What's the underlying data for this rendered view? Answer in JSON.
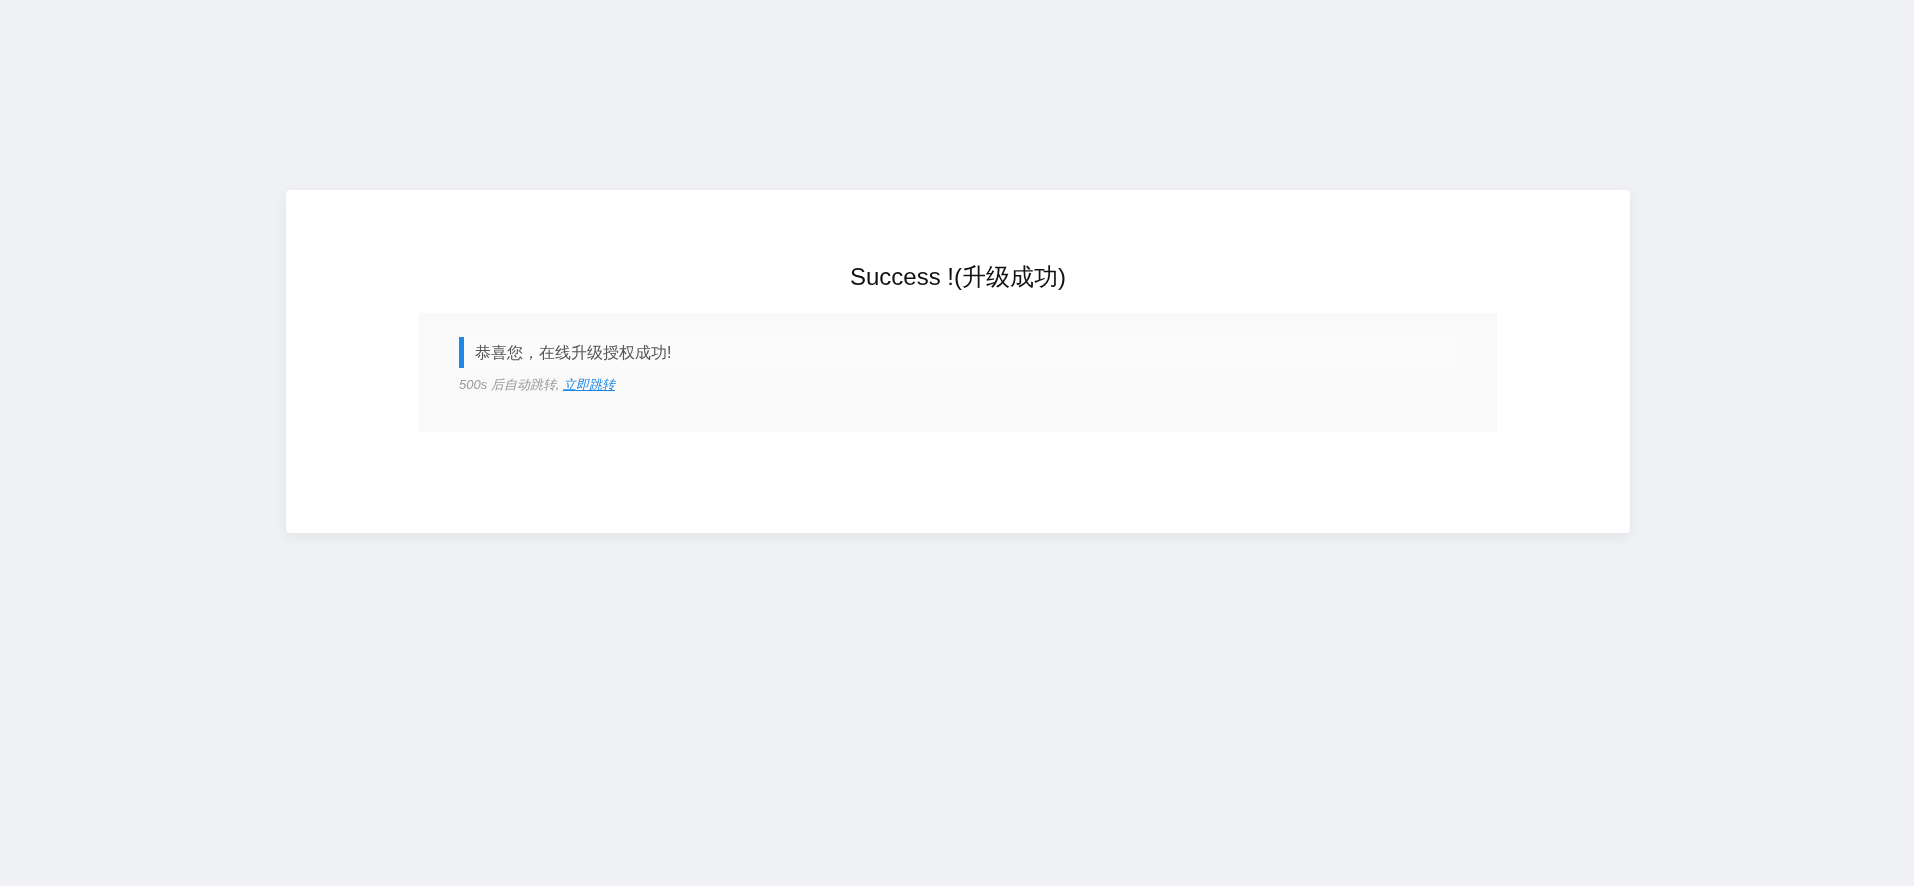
{
  "title": "Success !(升级成功)",
  "message": "恭喜您，在线升级授权成功!",
  "redirect": {
    "text": "500s 后自动跳转,",
    "link": "立即跳转"
  }
}
